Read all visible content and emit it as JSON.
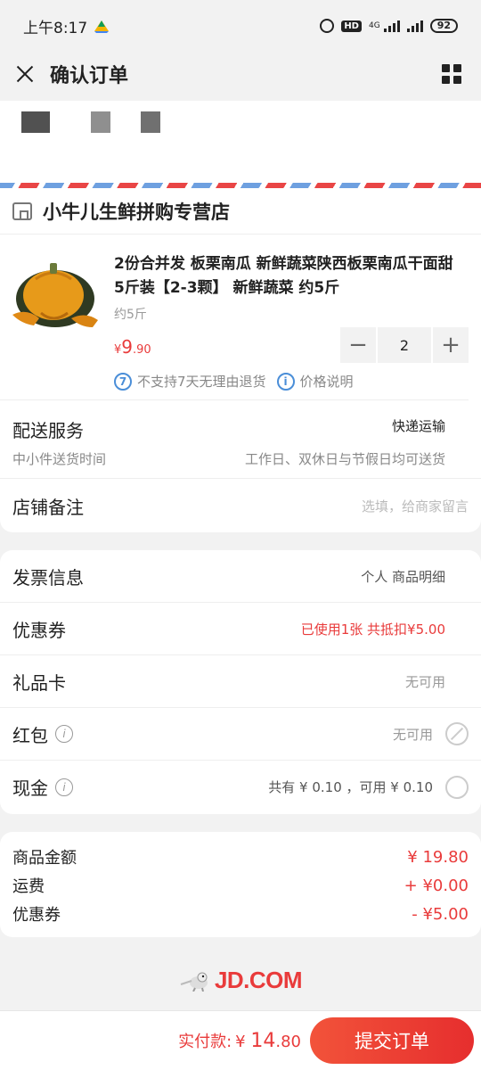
{
  "status": {
    "time": "上午8:17",
    "net": "4G",
    "battery": "92"
  },
  "nav": {
    "title": "确认订单"
  },
  "shop": {
    "name": "小牛儿生鲜拼购专营店",
    "product": {
      "title": "2份合并发 板栗南瓜 新鲜蔬菜陕西板栗南瓜干面甜 5斤装【2-3颗】 新鲜蔬菜 约5斤",
      "spec": "约5斤",
      "price_symbol": "¥",
      "price_int": "9",
      "price_dec": ".90",
      "qty_minus": "−",
      "qty": "2",
      "qty_plus": "+",
      "tag_return": "不支持7天无理由退货",
      "tag_price": "价格说明"
    },
    "delivery": {
      "label": "配送服务",
      "value": "快递运输",
      "sub_label": "中小件送货时间",
      "sub_value": "工作日、双休日与节假日均可送货"
    },
    "remark": {
      "label": "店铺备注",
      "placeholder": "选填，给商家留言"
    }
  },
  "info": {
    "invoice": {
      "label": "发票信息",
      "value": "个人 商品明细"
    },
    "coupon": {
      "label": "优惠券",
      "value": "已使用1张 共抵扣¥5.00"
    },
    "giftcard": {
      "label": "礼品卡",
      "value": "无可用"
    },
    "redpacket": {
      "label": "红包",
      "value": "无可用"
    },
    "cash": {
      "label": "现金",
      "value": "共有 ¥ 0.10 ，可用 ¥ 0.10"
    }
  },
  "summary": {
    "goods_label": "商品金额",
    "goods_value": "¥ 19.80",
    "freight_label": "运费",
    "freight_value": "+ ¥0.00",
    "coupon_label": "优惠券",
    "coupon_value": "- ¥5.00"
  },
  "brand": {
    "text": "JD.COM"
  },
  "footer": {
    "total_label": "实付款:",
    "total_symbol": "¥ ",
    "total_int": "14",
    "total_dec": ".80",
    "submit": "提交订单"
  },
  "colors": {
    "accent": "#e93b3b",
    "airmail_blue": "#6ea0e0"
  },
  "icons": [
    "close-icon",
    "grid-icon",
    "store-icon",
    "no-return-icon",
    "info-icon",
    "disabled-icon",
    "radio-icon",
    "jd-dog-icon"
  ]
}
